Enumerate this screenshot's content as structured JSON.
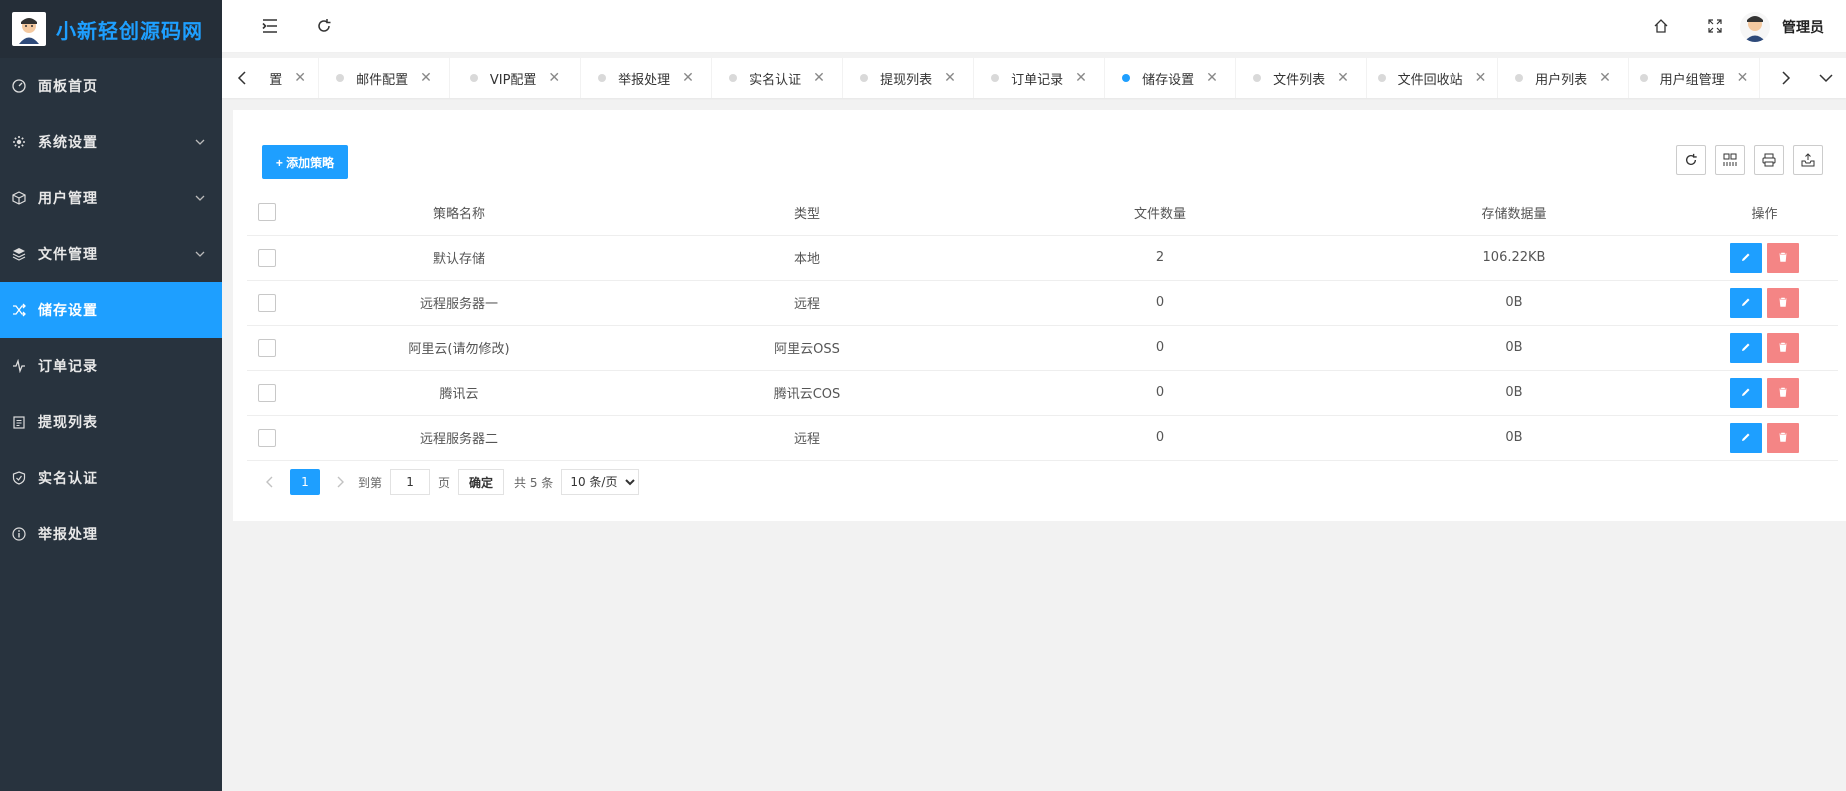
{
  "sidebar": {
    "logo_title": "小新轻创源码网",
    "items": [
      {
        "label": "面板首页",
        "icon": "dashboard-icon",
        "expandable": false,
        "active": false
      },
      {
        "label": "系统设置",
        "icon": "gear-icon",
        "expandable": true,
        "active": false
      },
      {
        "label": "用户管理",
        "icon": "cube-icon",
        "expandable": true,
        "active": false
      },
      {
        "label": "文件管理",
        "icon": "layers-icon",
        "expandable": true,
        "active": false
      },
      {
        "label": "储存设置",
        "icon": "shuffle-icon",
        "expandable": false,
        "active": true
      },
      {
        "label": "订单记录",
        "icon": "pulse-icon",
        "expandable": false,
        "active": false
      },
      {
        "label": "提现列表",
        "icon": "clipboard-icon",
        "expandable": false,
        "active": false
      },
      {
        "label": "实名认证",
        "icon": "shield-check-icon",
        "expandable": false,
        "active": false
      },
      {
        "label": "举报处理",
        "icon": "info-circle-icon",
        "expandable": false,
        "active": false
      }
    ]
  },
  "header": {
    "user_name": "管理员"
  },
  "tabs": [
    {
      "label": "置",
      "active": false
    },
    {
      "label": "邮件配置",
      "active": false
    },
    {
      "label": "VIP配置",
      "active": false
    },
    {
      "label": "举报处理",
      "active": false
    },
    {
      "label": "实名认证",
      "active": false
    },
    {
      "label": "提现列表",
      "active": false
    },
    {
      "label": "订单记录",
      "active": false
    },
    {
      "label": "储存设置",
      "active": true
    },
    {
      "label": "文件列表",
      "active": false
    },
    {
      "label": "文件回收站",
      "active": false
    },
    {
      "label": "用户列表",
      "active": false
    },
    {
      "label": "用户组管理",
      "active": false
    }
  ],
  "toolbar": {
    "add_label": "+ 添加策略"
  },
  "table": {
    "headers": [
      "策略名称",
      "类型",
      "文件数量",
      "存储数据量",
      "操作"
    ],
    "rows": [
      {
        "name": "默认存储",
        "type": "本地",
        "count": "2",
        "size": "106.22KB"
      },
      {
        "name": "远程服务器一",
        "type": "远程",
        "count": "0",
        "size": "0B"
      },
      {
        "name": "阿里云(请勿修改)",
        "type": "阿里云OSS",
        "count": "0",
        "size": "0B"
      },
      {
        "name": "腾讯云",
        "type": "腾讯云COS",
        "count": "0",
        "size": "0B"
      },
      {
        "name": "远程服务器二",
        "type": "远程",
        "count": "0",
        "size": "0B"
      }
    ]
  },
  "pager": {
    "current_page": "1",
    "goto_label": "到第",
    "goto_value": "1",
    "page_unit": "页",
    "confirm_label": "确定",
    "total_label": "共 5 条",
    "page_size_option": "10 条/页"
  },
  "colors": {
    "accent": "#1e9fff",
    "sidebar_bg": "#28333e",
    "danger": "#f37070"
  }
}
